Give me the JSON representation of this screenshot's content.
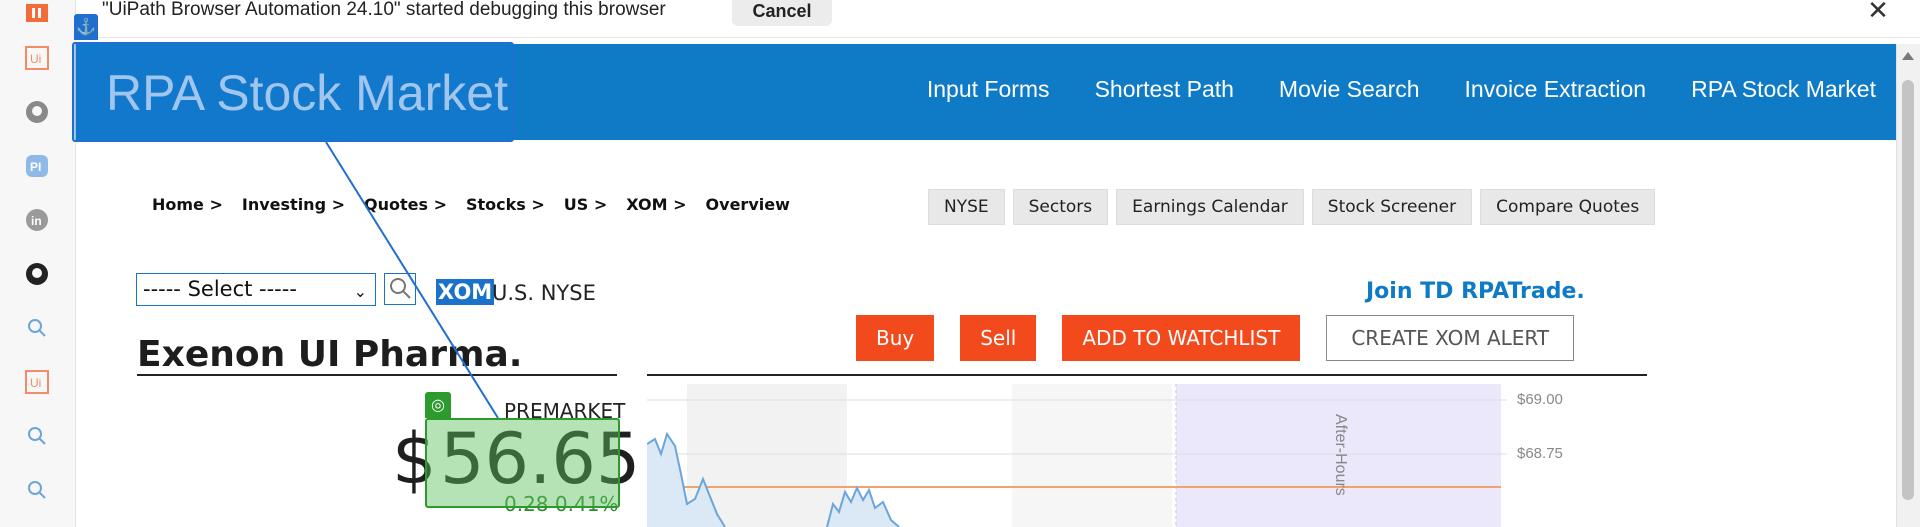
{
  "debug_bar": {
    "message": "\"UiPath Browser Automation 24.10\" started debugging this browser",
    "cancel_label": "Cancel",
    "close_glyph": "✕"
  },
  "rail_icons": [
    "uipath-app-icon",
    "uipath-icon",
    "github-icon",
    "pi-icon",
    "linkedin-icon",
    "github-icon",
    "search-icon",
    "uipath-icon",
    "search-icon",
    "search-icon"
  ],
  "site": {
    "brand": "RPA Stock Market",
    "nav": [
      "Input Forms",
      "Shortest Path",
      "Movie Search",
      "Invoice Extraction",
      "RPA Stock Market"
    ]
  },
  "breadcrumb": [
    "Home >",
    "Investing >",
    "Quotes >",
    "Stocks >",
    "US >",
    "XOM >",
    "Overview"
  ],
  "tabs": [
    "NYSE",
    "Sectors",
    "Earnings Calendar",
    "Stock Screener",
    "Compare Quotes"
  ],
  "select": {
    "value": "----- Select -----"
  },
  "symbol": {
    "ticker": "XOM",
    "exchange": "U.S. NYSE"
  },
  "join_label": "Join TD RPATrade.",
  "actions": {
    "buy": "Buy",
    "sell": "Sell",
    "watchlist": "ADD TO WATCHLIST",
    "alert": "CREATE XOM ALERT"
  },
  "company": "Exenon UI Pharma.",
  "quote": {
    "session": "PREMARKET",
    "currency": "$",
    "price": "56.65",
    "change": "0.28 0.41%"
  },
  "chart_data": {
    "type": "line",
    "y_ticks": [
      "$69.00",
      "$68.75"
    ],
    "annotation": "After-Hours",
    "colors": {
      "line": "#6aa6dc",
      "reference": "#f2a36b",
      "after_hours": "#ece8fb"
    }
  },
  "colors": {
    "nav": "#0f7ac6",
    "accent_red": "#f24a1d",
    "anchor_overlay": "#1f6fcf",
    "target_overlay": "#2c9a2c"
  }
}
